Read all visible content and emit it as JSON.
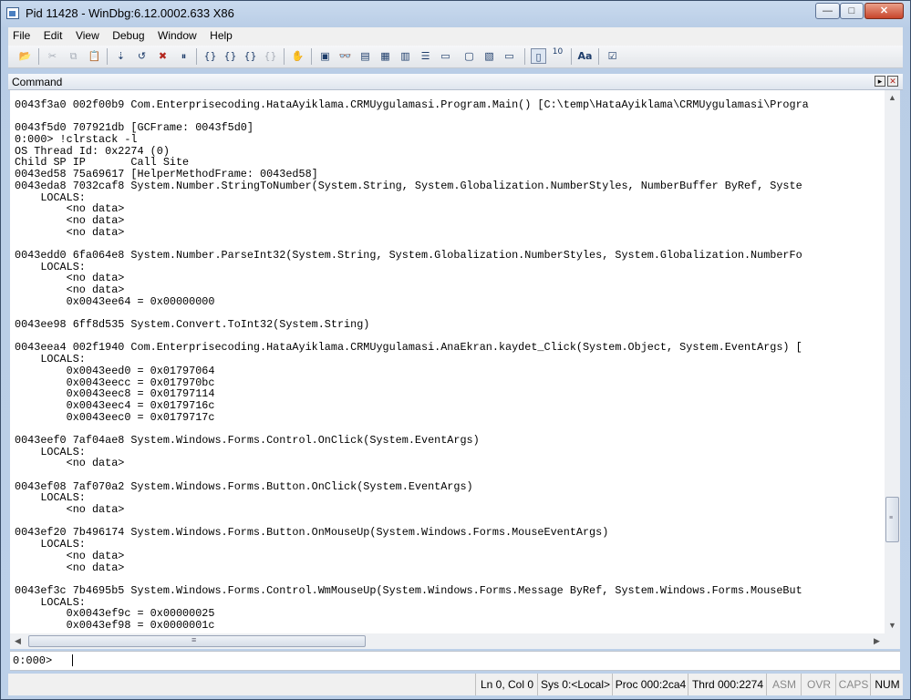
{
  "window": {
    "title": "Pid 11428 - WinDbg:6.12.0002.633 X86",
    "minimize_glyph": "—",
    "maximize_glyph": "□",
    "close_glyph": "✕"
  },
  "menu": [
    "File",
    "Edit",
    "View",
    "Debug",
    "Window",
    "Help"
  ],
  "toolbar": {
    "icons": [
      {
        "name": "open-icon",
        "glyph": "📂",
        "enabled": true
      },
      {
        "name": "cut-icon",
        "glyph": "✂",
        "enabled": false
      },
      {
        "name": "copy-icon",
        "glyph": "⧉",
        "enabled": false
      },
      {
        "name": "paste-icon",
        "glyph": "📋",
        "enabled": false
      },
      {
        "name": "go-icon",
        "glyph": "⇣",
        "enabled": true
      },
      {
        "name": "restart-icon",
        "glyph": "↺",
        "enabled": true
      },
      {
        "name": "stop-debugging-icon",
        "glyph": "✖",
        "enabled": true
      },
      {
        "name": "break-icon",
        "glyph": "⏸",
        "enabled": true
      },
      {
        "name": "step-into-icon",
        "glyph": "{}",
        "enabled": true
      },
      {
        "name": "step-over-icon",
        "glyph": "{}",
        "enabled": true
      },
      {
        "name": "step-out-icon",
        "glyph": "{}",
        "enabled": true
      },
      {
        "name": "run-to-cursor-icon",
        "glyph": "{}",
        "enabled": false
      },
      {
        "name": "insert-breakpoint-icon",
        "glyph": "✋",
        "enabled": true
      },
      {
        "name": "command-window-icon",
        "glyph": "▣",
        "enabled": true
      },
      {
        "name": "watch-window-icon",
        "glyph": "👓",
        "enabled": true
      },
      {
        "name": "locals-window-icon",
        "glyph": "▤",
        "enabled": true
      },
      {
        "name": "registers-window-icon",
        "glyph": "▦",
        "enabled": true
      },
      {
        "name": "memory-window-icon",
        "glyph": "▥",
        "enabled": true
      },
      {
        "name": "call-stack-window-icon",
        "glyph": "☰",
        "enabled": true
      },
      {
        "name": "disassembly-window-icon",
        "glyph": "▭",
        "enabled": true
      },
      {
        "name": "scratch-pad-icon",
        "glyph": "▢",
        "enabled": true
      },
      {
        "name": "processes-threads-icon",
        "glyph": "▧",
        "enabled": true
      },
      {
        "name": "source-mode-icon",
        "glyph": "▯",
        "enabled": true,
        "active": true
      },
      {
        "name": "hex-display-icon",
        "glyph": "10",
        "enabled": true
      },
      {
        "name": "font-icon",
        "glyph": "Aa",
        "enabled": true
      },
      {
        "name": "options-icon",
        "glyph": "☑",
        "enabled": true
      }
    ]
  },
  "pane": {
    "title": "Command",
    "dock_glyph": "▸",
    "close_glyph": "✕"
  },
  "output_lines": [
    "0043f3a0 002f00b9 Com.Enterprisecoding.HataAyiklama.CRMUygulamasi.Program.Main() [C:\\temp\\HataAyiklama\\CRMUygulamasi\\Progra",
    "",
    "0043f5d0 707921db [GCFrame: 0043f5d0]",
    "0:000> !clrstack -l",
    "OS Thread Id: 0x2274 (0)",
    "Child SP IP       Call Site",
    "0043ed58 75a69617 [HelperMethodFrame: 0043ed58]",
    "0043eda8 7032caf8 System.Number.StringToNumber(System.String, System.Globalization.NumberStyles, NumberBuffer ByRef, Syste",
    "    LOCALS:",
    "        <no data>",
    "        <no data>",
    "        <no data>",
    "",
    "0043edd0 6fa064e8 System.Number.ParseInt32(System.String, System.Globalization.NumberStyles, System.Globalization.NumberFo",
    "    LOCALS:",
    "        <no data>",
    "        <no data>",
    "        0x0043ee64 = 0x00000000",
    "",
    "0043ee98 6ff8d535 System.Convert.ToInt32(System.String)",
    "",
    "0043eea4 002f1940 Com.Enterprisecoding.HataAyiklama.CRMUygulamasi.AnaEkran.kaydet_Click(System.Object, System.EventArgs) [",
    "    LOCALS:",
    "        0x0043eed0 = 0x01797064",
    "        0x0043eecc = 0x017970bc",
    "        0x0043eec8 = 0x01797114",
    "        0x0043eec4 = 0x0179716c",
    "        0x0043eec0 = 0x0179717c",
    "",
    "0043eef0 7af04ae8 System.Windows.Forms.Control.OnClick(System.EventArgs)",
    "    LOCALS:",
    "        <no data>",
    "",
    "0043ef08 7af070a2 System.Windows.Forms.Button.OnClick(System.EventArgs)",
    "    LOCALS:",
    "        <no data>",
    "",
    "0043ef20 7b496174 System.Windows.Forms.Button.OnMouseUp(System.Windows.Forms.MouseEventArgs)",
    "    LOCALS:",
    "        <no data>",
    "        <no data>",
    "",
    "0043ef3c 7b4695b5 System.Windows.Forms.Control.WmMouseUp(System.Windows.Forms.Message ByRef, System.Windows.Forms.MouseBut",
    "    LOCALS:",
    "        0x0043ef9c = 0x00000025",
    "        0x0043ef98 = 0x0000001c"
  ],
  "command": {
    "prompt": "0:000>",
    "value": ""
  },
  "status": {
    "cursor": "Ln 0, Col 0",
    "sys": "Sys 0:<Local>",
    "proc": "Proc 000:2ca4",
    "thread": "Thrd 000:2274",
    "asm": "ASM",
    "ovr": "OVR",
    "caps": "CAPS",
    "num": "NUM"
  },
  "scroll": {
    "up_glyph": "▲",
    "down_glyph": "▼",
    "left_glyph": "◀",
    "right_glyph": "▶",
    "grip_glyph": "≡"
  }
}
